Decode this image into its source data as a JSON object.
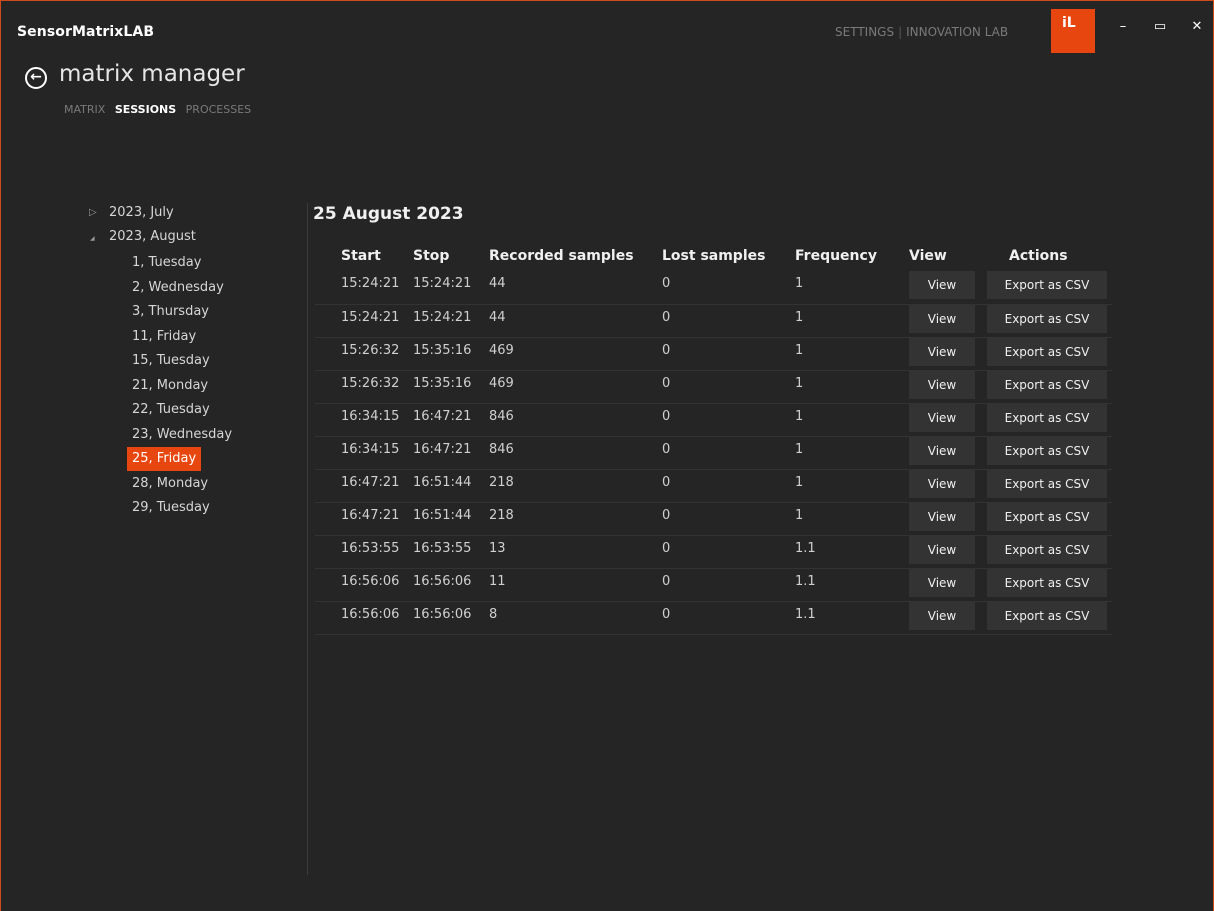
{
  "window": {
    "app_title": "SensorMatrixLAB",
    "top_links": [
      "SETTINGS",
      "INNOVATION LAB"
    ],
    "logo_text": "iL",
    "controls": {
      "minimize": "–",
      "maximize": "▭",
      "close": "✕"
    }
  },
  "header": {
    "back_icon": "back-arrow-icon",
    "title": "matrix manager",
    "subnav": [
      {
        "label": "MATRIX",
        "active": false
      },
      {
        "label": "SESSIONS",
        "active": true
      },
      {
        "label": "PROCESSES",
        "active": false
      }
    ]
  },
  "tree": {
    "months": [
      {
        "label": "2023, July",
        "expanded": false,
        "days": []
      },
      {
        "label": "2023, August",
        "expanded": true,
        "days": [
          {
            "label": "1, Tuesday",
            "selected": false
          },
          {
            "label": "2, Wednesday",
            "selected": false
          },
          {
            "label": "3, Thursday",
            "selected": false
          },
          {
            "label": "11, Friday",
            "selected": false
          },
          {
            "label": "15, Tuesday",
            "selected": false
          },
          {
            "label": "21, Monday",
            "selected": false
          },
          {
            "label": "22, Tuesday",
            "selected": false
          },
          {
            "label": "23, Wednesday",
            "selected": false
          },
          {
            "label": "25, Friday",
            "selected": true
          },
          {
            "label": "28, Monday",
            "selected": false
          },
          {
            "label": "29, Tuesday",
            "selected": false
          }
        ]
      }
    ]
  },
  "main": {
    "title": "25 August 2023",
    "columns": [
      "Start",
      "Stop",
      "Recorded samples",
      "Lost samples",
      "Frequency",
      "View",
      "Actions"
    ],
    "view_label": "View",
    "export_label": "Export as CSV",
    "rows": [
      {
        "start": "15:24:21",
        "stop": "15:24:21",
        "recorded": "44",
        "lost": "0",
        "frequency": "1"
      },
      {
        "start": "15:24:21",
        "stop": "15:24:21",
        "recorded": "44",
        "lost": "0",
        "frequency": "1"
      },
      {
        "start": "15:26:32",
        "stop": "15:35:16",
        "recorded": "469",
        "lost": "0",
        "frequency": "1"
      },
      {
        "start": "15:26:32",
        "stop": "15:35:16",
        "recorded": "469",
        "lost": "0",
        "frequency": "1"
      },
      {
        "start": "16:34:15",
        "stop": "16:47:21",
        "recorded": "846",
        "lost": "0",
        "frequency": "1"
      },
      {
        "start": "16:34:15",
        "stop": "16:47:21",
        "recorded": "846",
        "lost": "0",
        "frequency": "1"
      },
      {
        "start": "16:47:21",
        "stop": "16:51:44",
        "recorded": "218",
        "lost": "0",
        "frequency": "1"
      },
      {
        "start": "16:47:21",
        "stop": "16:51:44",
        "recorded": "218",
        "lost": "0",
        "frequency": "1"
      },
      {
        "start": "16:53:55",
        "stop": "16:53:55",
        "recorded": "13",
        "lost": "0",
        "frequency": "1.1"
      },
      {
        "start": "16:56:06",
        "stop": "16:56:06",
        "recorded": "11",
        "lost": "0",
        "frequency": "1.1"
      },
      {
        "start": "16:56:06",
        "stop": "16:56:06",
        "recorded": "8",
        "lost": "0",
        "frequency": "1.1"
      }
    ]
  },
  "colors": {
    "accent": "#e8460f",
    "background": "#252525",
    "button": "#333333"
  }
}
